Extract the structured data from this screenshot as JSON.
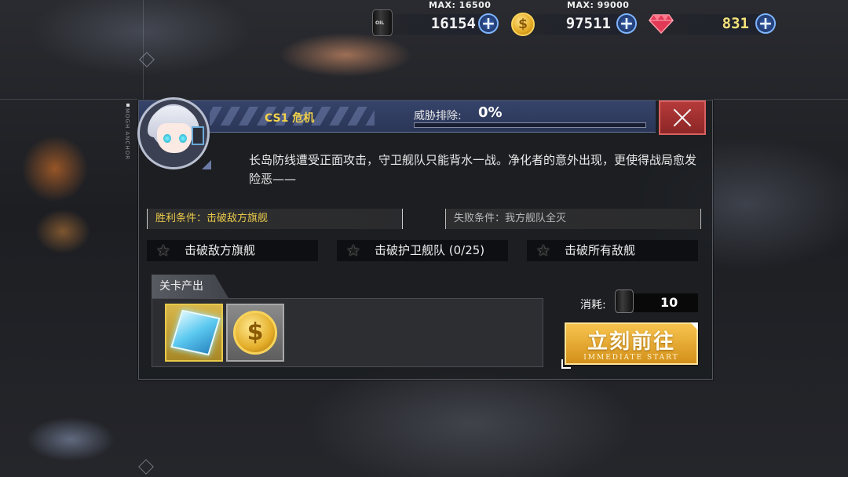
{
  "resources": {
    "oil": {
      "max_label": "MAX: 16500",
      "value": "16154",
      "icon": "oil-barrel-icon",
      "icon_text": "OIL"
    },
    "gold": {
      "max_label": "MAX: 99000",
      "value": "97511",
      "icon": "gold-coin-icon",
      "icon_text": "$"
    },
    "gems": {
      "value": "831",
      "icon": "gem-icon"
    },
    "plus_label": "+"
  },
  "side": {
    "vertical_text": "MOGH ANCHOR"
  },
  "panel": {
    "title": "CS1 危机",
    "threat_label": "威胁排除:",
    "threat_value": "0%",
    "threat_progress": 0,
    "description": "长岛防线遭受正面攻击，守卫舰队只能背水一战。净化者的意外出现，更使得战局愈发险恶——",
    "victory_condition": "胜利条件：击破敌方旗舰",
    "failure_condition": "失败条件：我方舰队全灭",
    "objectives": [
      {
        "label": "击破敌方旗舰",
        "icon": "star-icon"
      },
      {
        "label": "击破护卫舰队 (0/25)",
        "icon": "star-icon"
      },
      {
        "label": "击破所有敌舰",
        "icon": "star-icon"
      }
    ],
    "star_glyph": "★",
    "output_label": "关卡产出",
    "output_items": [
      {
        "name": "cube-item",
        "icon": "blue-cube-icon"
      },
      {
        "name": "coin-item",
        "icon": "gold-coin-icon",
        "glyph": "$"
      }
    ],
    "cost_label": "消耗:",
    "cost_value": "10",
    "start_button": {
      "label": "立刻前往",
      "sub_label": "IMMEDIATE START"
    }
  },
  "colors": {
    "accent_gold": "#f2d24a",
    "close_red": "#b63a3a",
    "title_blue": "#36446b"
  }
}
